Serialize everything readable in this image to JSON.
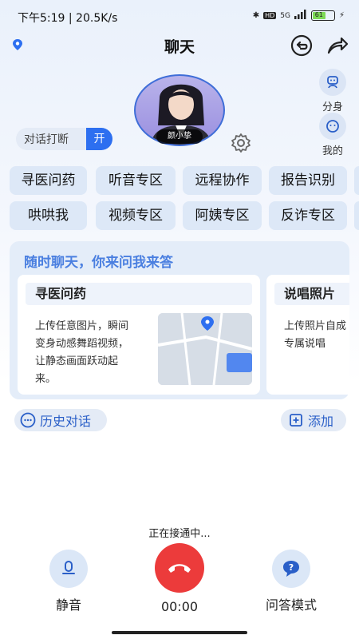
{
  "status_bar": {
    "time": "下午5:19 | 20.5K/s",
    "network": "5G",
    "battery": "61"
  },
  "header": {
    "title": "聊天"
  },
  "assistant": {
    "name": "颜小挚"
  },
  "side_buttons": {
    "clone_label": "分身",
    "mine_label": "我的"
  },
  "toggle": {
    "label": "对话打断",
    "state": "开"
  },
  "chips": [
    "寻医问药",
    "听音专区",
    "远程协作",
    "报告识别",
    "哄哄我",
    "视频专区",
    "阿姨专区",
    "反诈专区"
  ],
  "feature_card": {
    "heading": "随时聊天，你来问我来答",
    "items": [
      {
        "title": "寻医问药",
        "desc": "上传任意图片，瞬间变身动感舞蹈视频，让静态画面跃动起来。"
      },
      {
        "title": "说唱照片",
        "desc": "上传照片自成专属说唱"
      }
    ]
  },
  "actions": {
    "history": "历史对话",
    "add": "添加"
  },
  "call": {
    "status": "正在接通中...",
    "mute_label": "静音",
    "timer": "00:00",
    "qa_label": "问答模式"
  },
  "colors": {
    "accent": "#2d6ff0",
    "hangup": "#ec3b3b",
    "chip_bg": "#dde8f7"
  }
}
